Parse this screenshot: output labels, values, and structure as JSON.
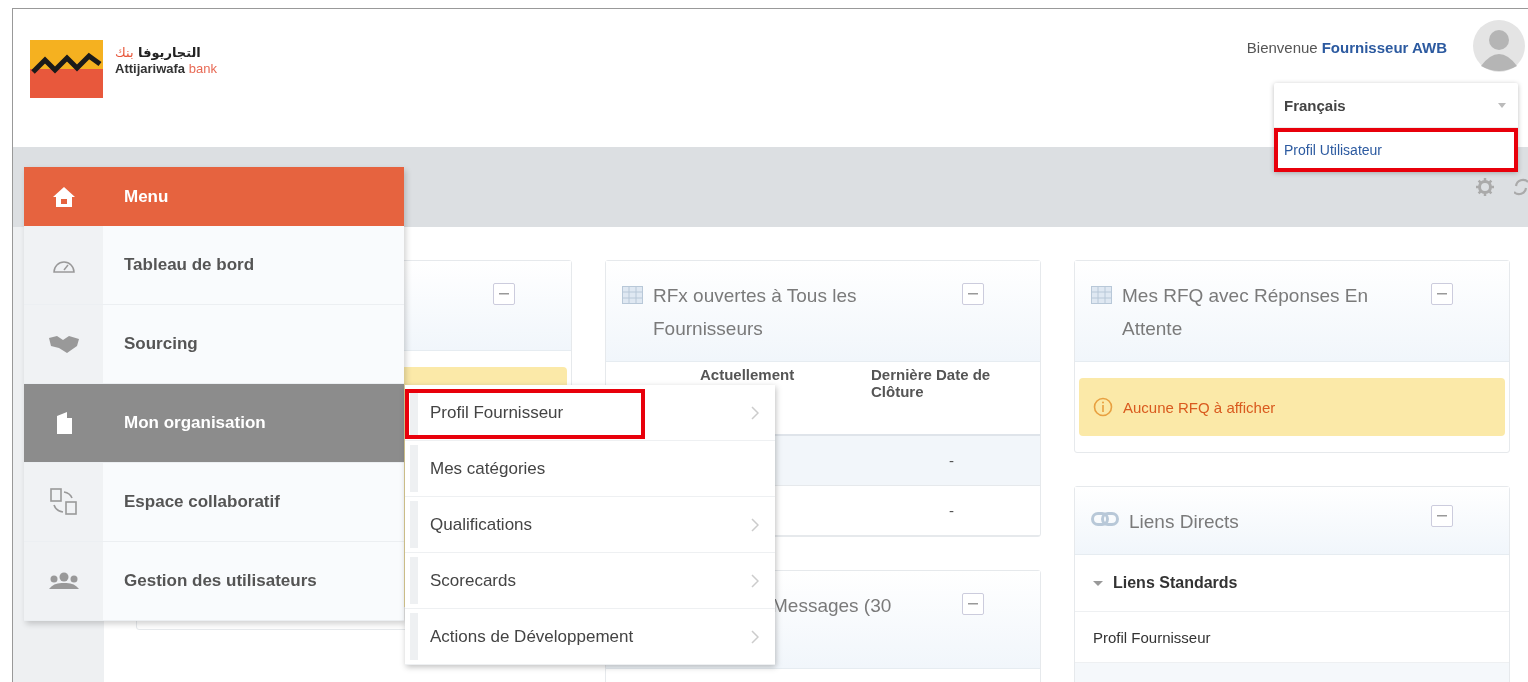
{
  "header": {
    "logo": {
      "arabic_name": "التجاريوفا",
      "arabic_suffix": "بنك",
      "name": "Attijariwafa",
      "suffix": "bank"
    },
    "welcome": "Bienvenue",
    "user_name": "Fournisseur AWB"
  },
  "user_dropdown": {
    "language": "Français",
    "items": [
      {
        "label": "Profil Utilisateur",
        "highlighted": true
      }
    ]
  },
  "menu": {
    "title": "Menu",
    "items": [
      {
        "label": "Tableau de bord",
        "selected": false
      },
      {
        "label": "Sourcing",
        "selected": false
      },
      {
        "label": "Mon organisation",
        "selected": true
      },
      {
        "label": "Espace collaboratif",
        "selected": false
      },
      {
        "label": "Gestion des utilisateurs",
        "selected": false
      }
    ]
  },
  "submenu": {
    "items": [
      {
        "label": "Profil Fournisseur",
        "has_children": true,
        "highlighted": true
      },
      {
        "label": "Mes catégories",
        "has_children": false,
        "highlighted": false
      },
      {
        "label": "Qualifications",
        "has_children": true,
        "highlighted": false
      },
      {
        "label": "Scorecards",
        "has_children": true,
        "highlighted": false
      },
      {
        "label": "Actions de Développement",
        "has_children": true,
        "highlighted": false
      }
    ]
  },
  "rfx_panel": {
    "title": "RFx ouvertes à Tous les Fournisseurs",
    "columns": [
      "Actuellement",
      "Dernière Date de Clôture"
    ],
    "rows": [
      {
        "closing_date": "-"
      },
      {
        "closing_date": "-"
      }
    ]
  },
  "messages_panel": {
    "title": "Messages (30"
  },
  "rfq_panel": {
    "title": "Mes RFQ avec Réponses En Attente",
    "alert": "Aucune RFQ à afficher"
  },
  "links_panel": {
    "title": "Liens Directs",
    "group": {
      "label": "Liens Standards",
      "expanded": true,
      "links": [
        "Profil Fournisseur"
      ]
    }
  }
}
